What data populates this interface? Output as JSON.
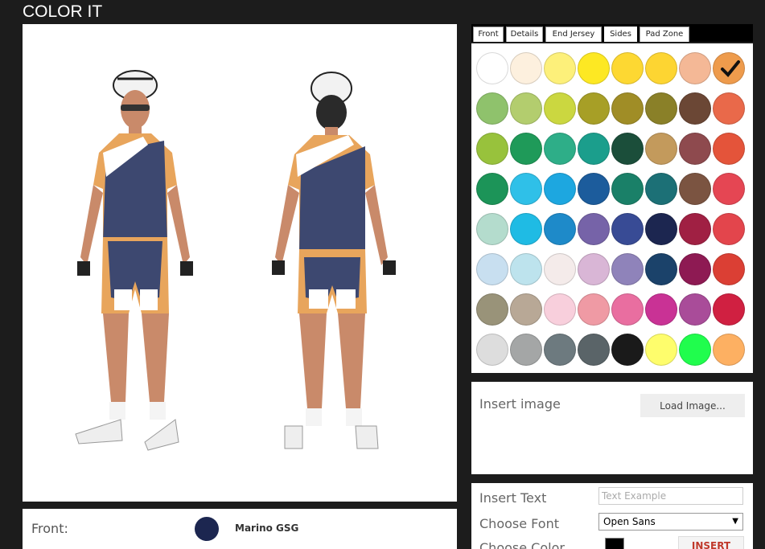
{
  "header": {
    "title": "COLOR IT"
  },
  "tabs": [
    {
      "label": "Front",
      "active": false
    },
    {
      "label": "Details",
      "active": false
    },
    {
      "label": "End Jersey",
      "active": false
    },
    {
      "label": "Sides",
      "active": true
    },
    {
      "label": "Pad Zone",
      "active": false
    }
  ],
  "palette": {
    "selected_index": 7,
    "colors": [
      "#ffffff",
      "#fdf0de",
      "#fdf07a",
      "#fde823",
      "#fdd832",
      "#fdd532",
      "#f4b896",
      "#ee9b4c",
      "#8fc26c",
      "#b3cd6e",
      "#cbd740",
      "#a79f26",
      "#a08d26",
      "#8a8028",
      "#6b4735",
      "#e9694a",
      "#98c23c",
      "#1f9a59",
      "#2eae88",
      "#1b9e8c",
      "#1b4e3a",
      "#c39a5c",
      "#8e4a4e",
      "#e4543a",
      "#1c9458",
      "#2fc0e8",
      "#1da7e0",
      "#1c5c9c",
      "#1a8068",
      "#1c7076",
      "#7b5441",
      "#e54653",
      "#b4dccd",
      "#1fbbe4",
      "#1e8ac9",
      "#7663a8",
      "#384b95",
      "#1c2650",
      "#a02043",
      "#e3454c",
      "#c8dff0",
      "#bde3ed",
      "#f4ebea",
      "#d9b6d6",
      "#8f83ba",
      "#1b426a",
      "#8e1a53",
      "#db3f34",
      "#999379",
      "#b8a896",
      "#f8cfdc",
      "#ef9aa4",
      "#e96ea0",
      "#c93295",
      "#a94c99",
      "#d02041",
      "#dddddd",
      "#a4a6a6",
      "#6d7a7f",
      "#5a6468",
      "#1a1a1a",
      "#fefd6c",
      "#20fd4d",
      "#fdb062"
    ]
  },
  "image_panel": {
    "label": "Insert image",
    "button": "Load Image..."
  },
  "text_panel": {
    "text_label": "Insert Text",
    "text_placeholder": "Text Example",
    "font_label": "Choose Font",
    "font_value": "Open Sans",
    "color_label": "Choose Color",
    "color_value": "#000000",
    "insert_button": "INSERT"
  },
  "front_selection": {
    "label": "Front:",
    "color_name": "Marino GSG",
    "color": "#1c2650"
  },
  "kit_colors": {
    "main": "#3d4870",
    "accent": "#e8a55c",
    "panel": "#ffffff",
    "skin": "#c98a6a"
  }
}
